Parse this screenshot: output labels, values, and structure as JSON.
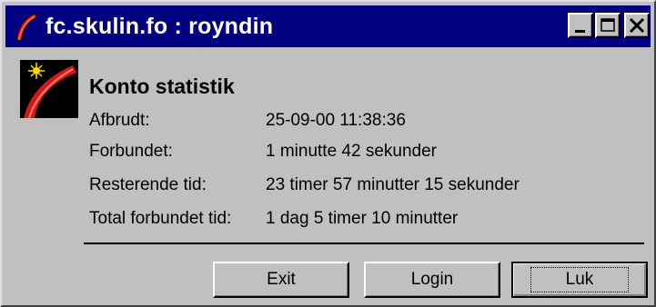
{
  "window": {
    "title": "fc.skulin.fo : royndin",
    "controls": [
      "minimize",
      "maximize",
      "close"
    ]
  },
  "heading": "Konto statistik",
  "stats": [
    {
      "label": "Afbrudt:",
      "value": "25-09-00 11:38:36"
    },
    {
      "label": "Forbundet:",
      "value": "1 minutte 42 sekunder"
    },
    {
      "label": "Resterende tid:",
      "value": "23 timer 57 minutter 15 sekunder"
    },
    {
      "label": "Total forbundet tid:",
      "value": "1 dag 5 timer 10 minutter"
    }
  ],
  "buttons": {
    "exit": "Exit",
    "login": "Login",
    "close": "Luk"
  },
  "colors": {
    "titlebar": "#000080",
    "face": "#c0c0c0",
    "icon_red": "#cc1010"
  },
  "icons": {
    "app": "red-comet-icon"
  }
}
